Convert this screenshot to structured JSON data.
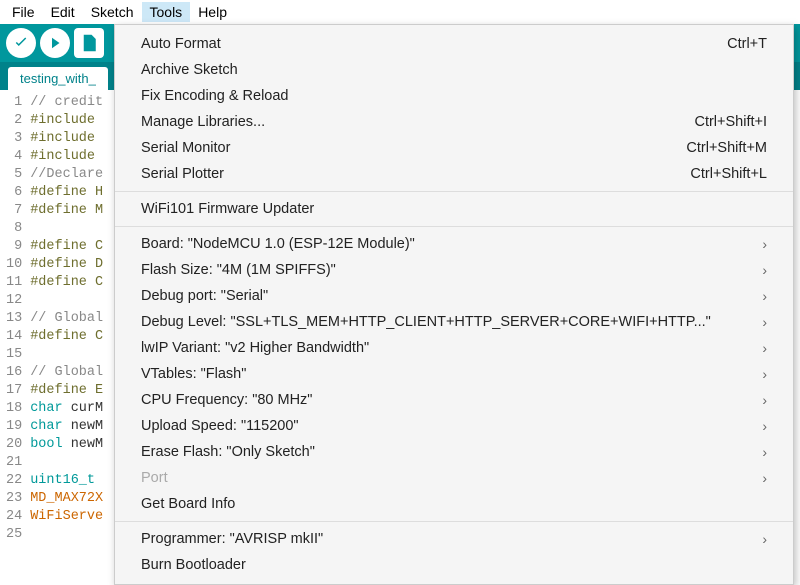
{
  "menubar": [
    "File",
    "Edit",
    "Sketch",
    "Tools",
    "Help"
  ],
  "menubar_active": "Tools",
  "tab_label": "testing_with_",
  "dropdown": {
    "group1": [
      {
        "label": "Auto Format",
        "shortcut": "Ctrl+T"
      },
      {
        "label": "Archive Sketch",
        "shortcut": ""
      },
      {
        "label": "Fix Encoding & Reload",
        "shortcut": ""
      },
      {
        "label": "Manage Libraries...",
        "shortcut": "Ctrl+Shift+I"
      },
      {
        "label": "Serial Monitor",
        "shortcut": "Ctrl+Shift+M"
      },
      {
        "label": "Serial Plotter",
        "shortcut": "Ctrl+Shift+L"
      }
    ],
    "group2": [
      {
        "label": "WiFi101 Firmware Updater",
        "shortcut": ""
      }
    ],
    "group3": [
      {
        "label": "Board: \"NodeMCU 1.0 (ESP-12E Module)\"",
        "sub": true
      },
      {
        "label": "Flash Size: \"4M (1M SPIFFS)\"",
        "sub": true
      },
      {
        "label": "Debug port: \"Serial\"",
        "sub": true
      },
      {
        "label": "Debug Level: \"SSL+TLS_MEM+HTTP_CLIENT+HTTP_SERVER+CORE+WIFI+HTTP...\"",
        "sub": true
      },
      {
        "label": "lwIP Variant: \"v2 Higher Bandwidth\"",
        "sub": true
      },
      {
        "label": "VTables: \"Flash\"",
        "sub": true
      },
      {
        "label": "CPU Frequency: \"80 MHz\"",
        "sub": true
      },
      {
        "label": "Upload Speed: \"115200\"",
        "sub": true
      },
      {
        "label": "Erase Flash: \"Only Sketch\"",
        "sub": true
      },
      {
        "label": "Port",
        "sub": true,
        "disabled": true
      },
      {
        "label": "Get Board Info"
      }
    ],
    "group4": [
      {
        "label": "Programmer: \"AVRISP mkII\"",
        "sub": true
      },
      {
        "label": "Burn Bootloader"
      }
    ]
  },
  "code": {
    "lines": [
      {
        "n": 1,
        "cls": "c-comment",
        "txt": "// credit"
      },
      {
        "n": 2,
        "cls": "c-pre",
        "txt": "#include "
      },
      {
        "n": 3,
        "cls": "c-pre",
        "txt": "#include "
      },
      {
        "n": 4,
        "cls": "c-pre",
        "txt": "#include "
      },
      {
        "n": 5,
        "cls": "c-comment",
        "txt": "//Declare"
      },
      {
        "n": 6,
        "cls": "c-pre",
        "txt": "#define H"
      },
      {
        "n": 7,
        "cls": "c-pre",
        "txt": "#define M"
      },
      {
        "n": 8,
        "cls": "",
        "txt": ""
      },
      {
        "n": 9,
        "cls": "c-pre",
        "txt": "#define C"
      },
      {
        "n": 10,
        "cls": "c-pre",
        "txt": "#define D"
      },
      {
        "n": 11,
        "cls": "c-pre",
        "txt": "#define C"
      },
      {
        "n": 12,
        "cls": "",
        "txt": ""
      },
      {
        "n": 13,
        "cls": "c-comment",
        "txt": "// Global"
      },
      {
        "n": 14,
        "cls": "c-pre",
        "txt": "#define C"
      },
      {
        "n": 15,
        "cls": "",
        "txt": ""
      },
      {
        "n": 16,
        "cls": "c-comment",
        "txt": "// Global"
      },
      {
        "n": 17,
        "cls": "c-pre",
        "txt": "#define E"
      },
      {
        "n": 18,
        "cls": "c-type",
        "txt": "char",
        "rest": " curM"
      },
      {
        "n": 19,
        "cls": "c-type",
        "txt": "char",
        "rest": " newM"
      },
      {
        "n": 20,
        "cls": "c-type",
        "txt": "bool",
        "rest": " newM"
      },
      {
        "n": 21,
        "cls": "",
        "txt": ""
      },
      {
        "n": 22,
        "cls": "c-type",
        "txt": "uint16_t"
      },
      {
        "n": 23,
        "cls": "c-cls",
        "txt": "MD_MAX72X"
      },
      {
        "n": 24,
        "cls": "c-cls",
        "txt": "WiFiServe"
      },
      {
        "n": 25,
        "cls": "",
        "txt": ""
      }
    ]
  }
}
